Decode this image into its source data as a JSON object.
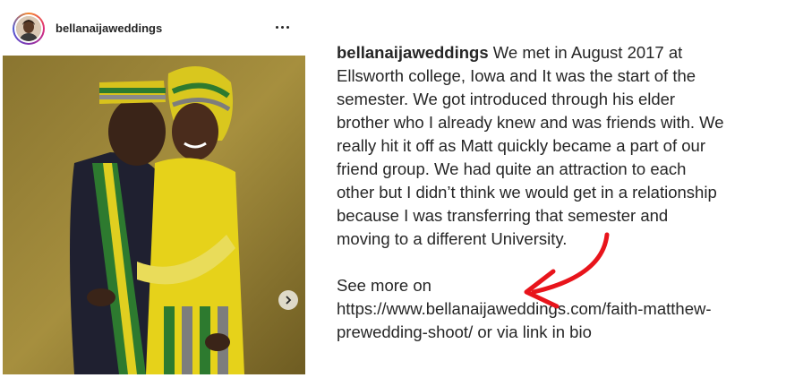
{
  "header": {
    "username": "bellanaijaweddings",
    "more_icon": "more-horizontal-icon"
  },
  "photo": {
    "alt": "Couple in yellow, green and grey traditional attire",
    "next_icon": "chevron-right-icon"
  },
  "caption": {
    "username": "bellanaijaweddings",
    "lines": [
      " We met in August 2017 at",
      "Ellsworth college, Iowa and It was the start of the",
      "semester. We got introduced through his elder",
      "brother who I already knew and was friends with. We",
      "really hit it off as Matt quickly became a part of our",
      "friend group. We had quite an attraction to each",
      "other but I didn’t think we would get in a relationship",
      "because I was transferring that semester and",
      "moving to a different University."
    ],
    "see_more": "See more on",
    "link_line1": "https://www.bellanaijaweddings.com/faith-matthew-",
    "link_line2": "prewedding-shoot/ or via link in bio"
  },
  "colors": {
    "arrow": "#e8141b",
    "text": "#262626"
  }
}
